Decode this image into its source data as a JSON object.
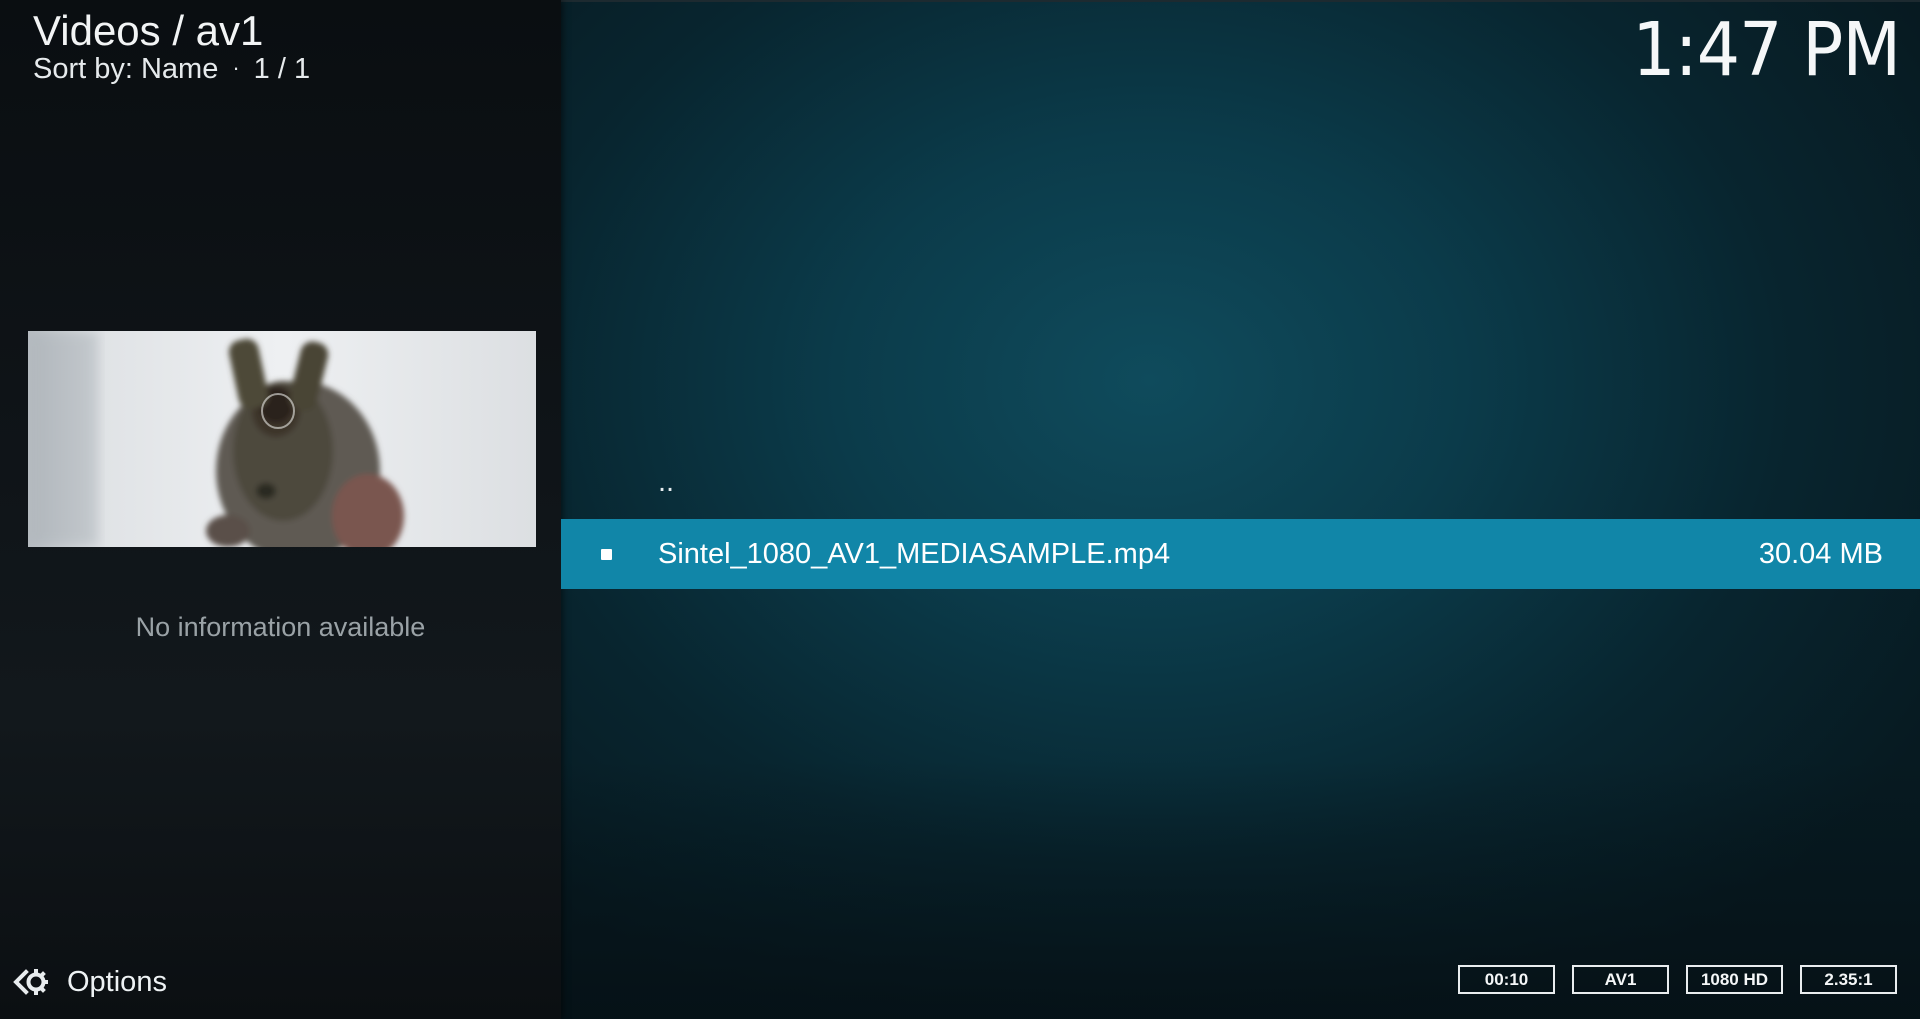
{
  "header": {
    "breadcrumb": "Videos / av1",
    "sort_prefix": "Sort by: Name",
    "separator": "·",
    "page_count": "1 / 1",
    "clock": "1:47 PM"
  },
  "info_panel": {
    "no_info_text": "No information available"
  },
  "options": {
    "label": "Options",
    "icon": "options-gear-arrow-icon"
  },
  "file_list": {
    "items": [
      {
        "label": "..",
        "type": "parent-folder"
      },
      {
        "label": "Sintel_1080_AV1_MEDIASAMPLE.mp4",
        "size": "30.04 MB",
        "focused": true
      }
    ]
  },
  "media_flags": {
    "duration": "00:10",
    "codec": "AV1",
    "resolution": "1080 HD",
    "aspect": "2.35:1"
  },
  "colors": {
    "focus": "#1186a8",
    "background": "#0b3b4a"
  }
}
